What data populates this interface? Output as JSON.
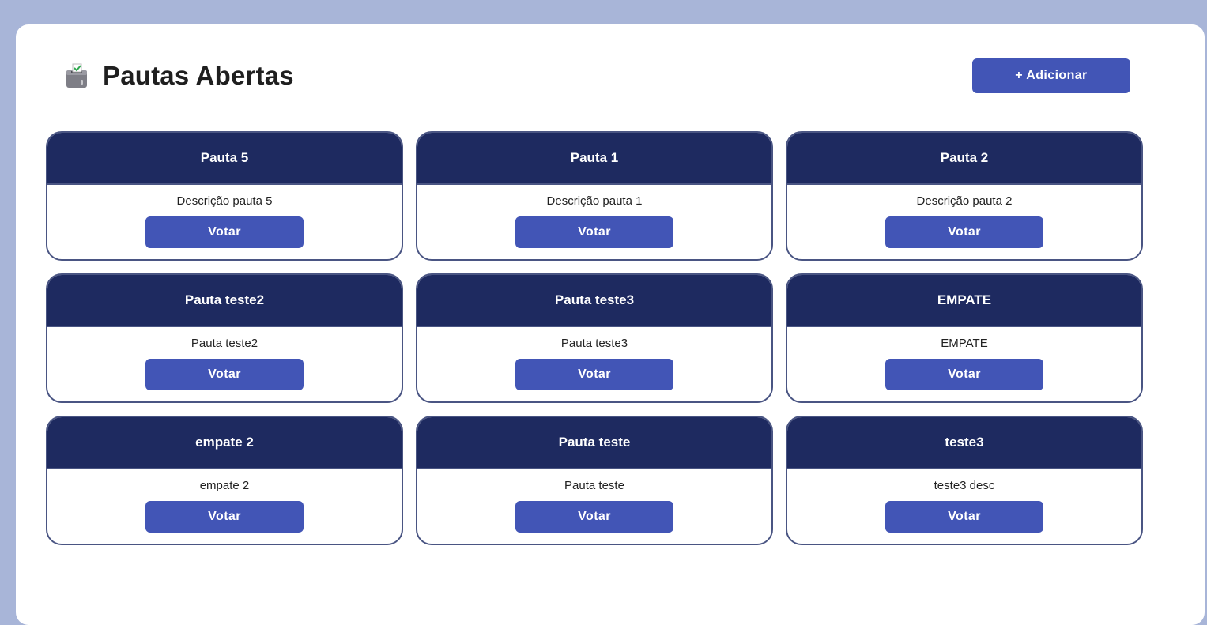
{
  "header": {
    "title": "Pautas Abertas",
    "icon": "ballot-box-icon",
    "add_label": "+ Adicionar"
  },
  "colors": {
    "background": "#a8b5d8",
    "panel": "#ffffff",
    "card_header": "#1e2a60",
    "card_border": "#4a5583",
    "button": "#4255b6"
  },
  "cards": [
    {
      "title": "Pauta 5",
      "description": "Descrição pauta 5",
      "button": "Votar"
    },
    {
      "title": "Pauta 1",
      "description": "Descrição pauta 1",
      "button": "Votar"
    },
    {
      "title": "Pauta 2",
      "description": "Descrição pauta 2",
      "button": "Votar"
    },
    {
      "title": "Pauta teste2",
      "description": "Pauta teste2",
      "button": "Votar"
    },
    {
      "title": "Pauta teste3",
      "description": "Pauta teste3",
      "button": "Votar"
    },
    {
      "title": "EMPATE",
      "description": "EMPATE",
      "button": "Votar"
    },
    {
      "title": "empate 2",
      "description": "empate 2",
      "button": "Votar"
    },
    {
      "title": "Pauta teste",
      "description": "Pauta teste",
      "button": "Votar"
    },
    {
      "title": "teste3",
      "description": "teste3 desc",
      "button": "Votar"
    }
  ]
}
